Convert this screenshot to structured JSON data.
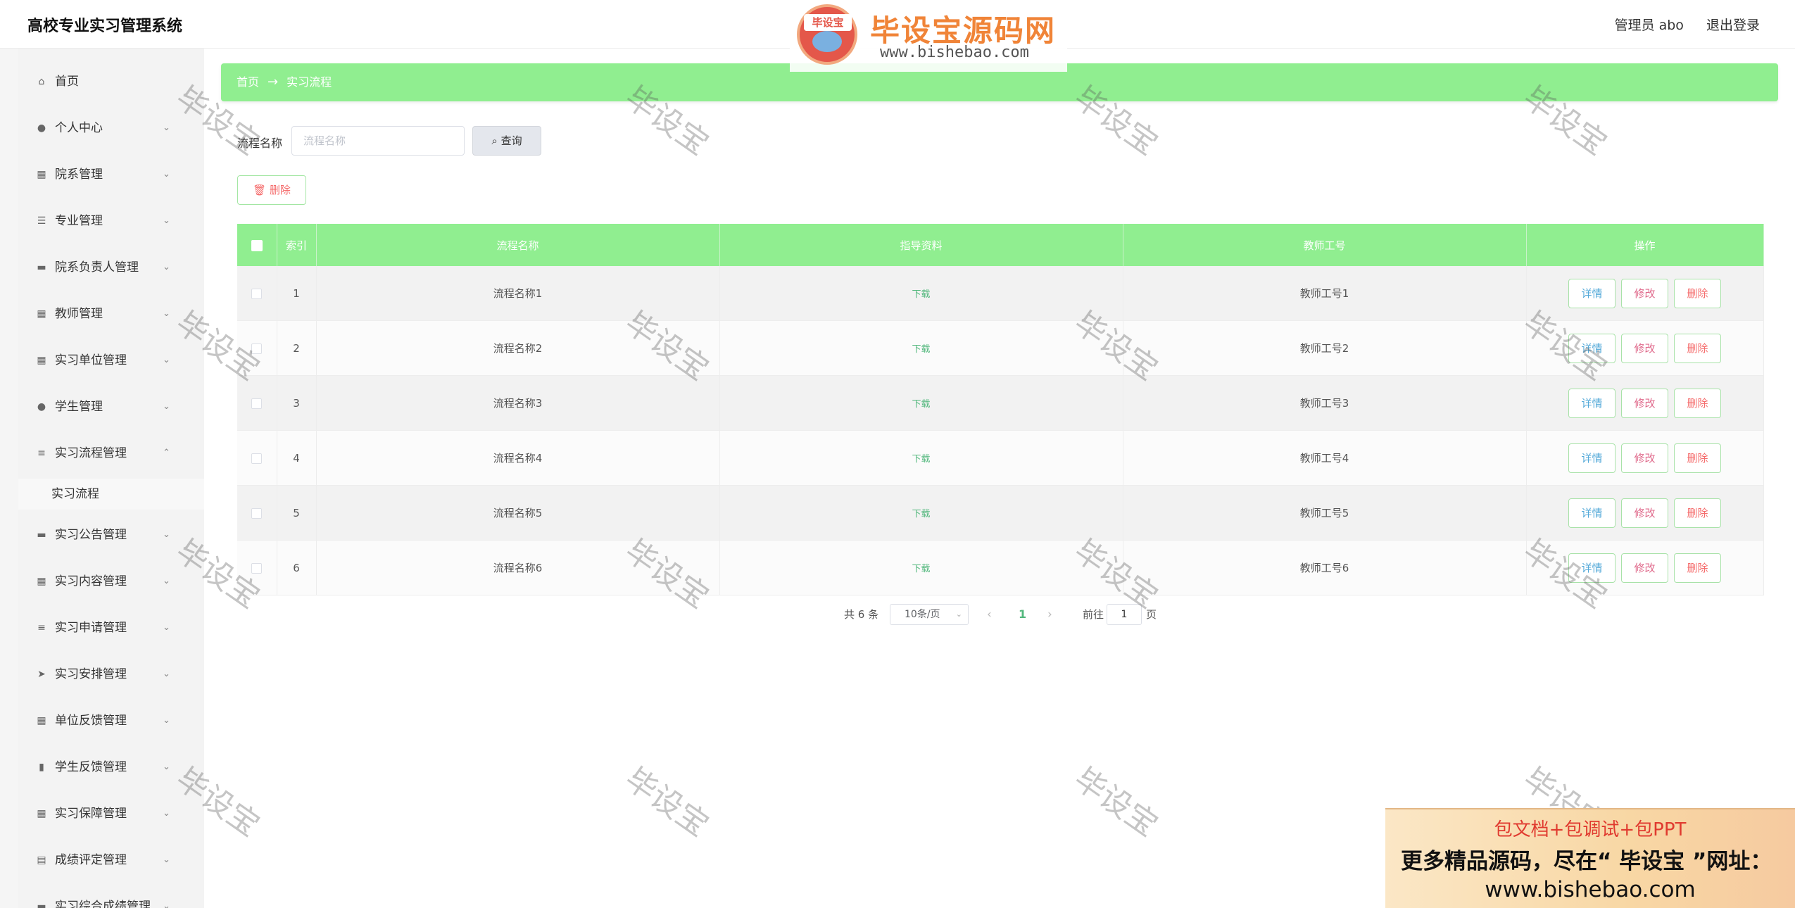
{
  "app": {
    "title": "高校专业实习管理系统"
  },
  "header": {
    "user_label": "管理员 abo",
    "logout_label": "退出登录"
  },
  "logo": {
    "badge": "毕设宝",
    "name": "毕设宝源码网",
    "url": "www.bishebao.com"
  },
  "sidebar": {
    "items": [
      {
        "label": "首页",
        "icon": "home-icon"
      },
      {
        "label": "个人中心",
        "icon": "user-icon"
      },
      {
        "label": "院系管理",
        "icon": "grid-icon"
      },
      {
        "label": "专业管理",
        "icon": "sliders-icon"
      },
      {
        "label": "院系负责人管理",
        "icon": "book-icon"
      },
      {
        "label": "教师管理",
        "icon": "grid-icon"
      },
      {
        "label": "实习单位管理",
        "icon": "grid-icon"
      },
      {
        "label": "学生管理",
        "icon": "user-icon"
      },
      {
        "label": "实习流程管理",
        "icon": "list-icon"
      },
      {
        "label": "实习公告管理",
        "icon": "chat-icon"
      },
      {
        "label": "实习内容管理",
        "icon": "grid-icon"
      },
      {
        "label": "实习申请管理",
        "icon": "list-icon"
      },
      {
        "label": "实习安排管理",
        "icon": "send-icon"
      },
      {
        "label": "单位反馈管理",
        "icon": "grid-icon"
      },
      {
        "label": "学生反馈管理",
        "icon": "chart-icon"
      },
      {
        "label": "实习保障管理",
        "icon": "grid-icon"
      },
      {
        "label": "成绩评定管理",
        "icon": "clipboard-icon"
      },
      {
        "label": "实习综合成绩管理",
        "icon": "book-icon"
      }
    ],
    "sub_item": "实习流程"
  },
  "breadcrumb": {
    "home": "首页",
    "separator": "→",
    "current": "实习流程"
  },
  "search": {
    "label": "流程名称",
    "placeholder": "流程名称",
    "button_label": "查询"
  },
  "toolbar": {
    "delete_label": "删除"
  },
  "table": {
    "columns": [
      "索引",
      "流程名称",
      "指导资料",
      "教师工号",
      "操作"
    ],
    "download_label": "下载",
    "actions": {
      "detail": "详情",
      "edit": "修改",
      "delete": "删除"
    },
    "rows": [
      {
        "index": "1",
        "name": "流程名称1",
        "teacher": "教师工号1"
      },
      {
        "index": "2",
        "name": "流程名称2",
        "teacher": "教师工号2"
      },
      {
        "index": "3",
        "name": "流程名称3",
        "teacher": "教师工号3"
      },
      {
        "index": "4",
        "name": "流程名称4",
        "teacher": "教师工号4"
      },
      {
        "index": "5",
        "name": "流程名称5",
        "teacher": "教师工号5"
      },
      {
        "index": "6",
        "name": "流程名称6",
        "teacher": "教师工号6"
      }
    ]
  },
  "pagination": {
    "total": "共 6 条",
    "page_size": "10条/页",
    "current": "1",
    "goto_label": "前往",
    "goto_value": "1",
    "page_suffix": "页"
  },
  "watermark": {
    "text": "毕设宝"
  },
  "ad": {
    "line1": "包文档+包调试+包PPT",
    "line2": "更多精品源码，尽在“ 毕设宝 ”网址：",
    "line3": "www.bishebao.com"
  },
  "colors": {
    "accent_green": "#90ee90",
    "link_green": "#52b77c",
    "danger": "#f56c6c"
  }
}
